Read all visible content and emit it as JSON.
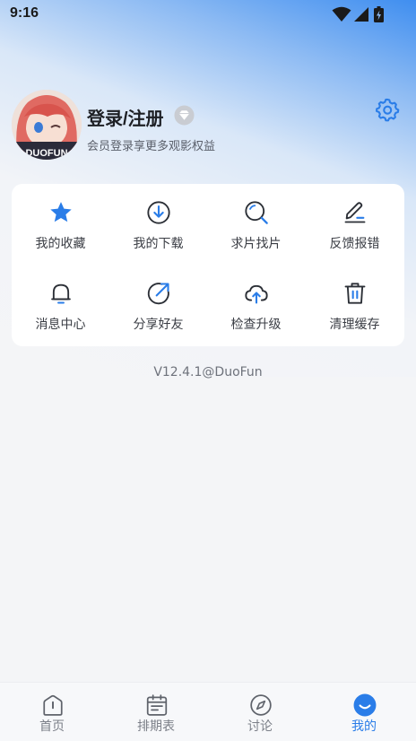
{
  "status_bar": {
    "time": "9:16",
    "icons": [
      "wifi-icon",
      "signal-icon",
      "battery-charging-icon"
    ]
  },
  "profile": {
    "avatar_overlay_text": "DUOFUN",
    "login_title": "登录/注册",
    "login_subtitle": "会员登录享更多观影权益",
    "vip_icon": "diamond-icon",
    "settings_icon": "gear-icon"
  },
  "menu": {
    "items": [
      {
        "label": "我的收藏",
        "icon": "star-icon"
      },
      {
        "label": "我的下载",
        "icon": "download-icon"
      },
      {
        "label": "求片找片",
        "icon": "search-icon"
      },
      {
        "label": "反馈报错",
        "icon": "edit-icon"
      },
      {
        "label": "消息中心",
        "icon": "bell-icon"
      },
      {
        "label": "分享好友",
        "icon": "share-icon"
      },
      {
        "label": "检查升级",
        "icon": "cloud-upload-icon"
      },
      {
        "label": "清理缓存",
        "icon": "trash-icon"
      }
    ]
  },
  "version": "V12.4.1@DuoFun",
  "bottom_nav": {
    "items": [
      {
        "label": "首页",
        "icon": "home-icon",
        "active": false
      },
      {
        "label": "排期表",
        "icon": "calendar-icon",
        "active": false
      },
      {
        "label": "讨论",
        "icon": "compass-icon",
        "active": false
      },
      {
        "label": "我的",
        "icon": "profile-smile-icon",
        "active": true
      }
    ]
  },
  "colors": {
    "accent": "#2a7de8",
    "card": "#ffffff",
    "page_bg": "#f4f5f7",
    "text_primary": "#1d1f24",
    "text_secondary": "#5a5f6a"
  }
}
